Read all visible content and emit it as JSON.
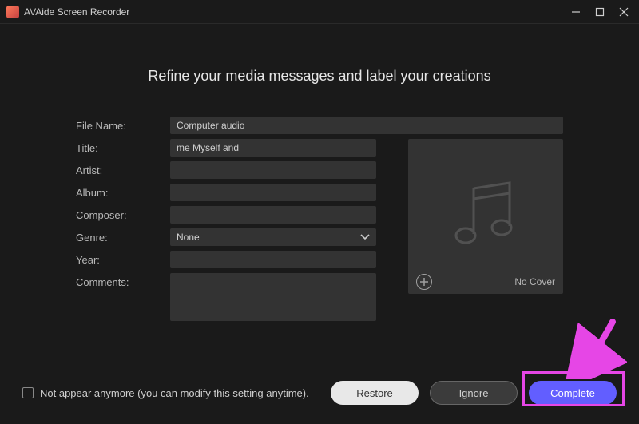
{
  "titlebar": {
    "app_name": "AVAide Screen Recorder"
  },
  "heading": "Refine your media messages and label your creations",
  "labels": {
    "file_name": "File Name:",
    "title": "Title:",
    "artist": "Artist:",
    "album": "Album:",
    "composer": "Composer:",
    "genre": "Genre:",
    "year": "Year:",
    "comments": "Comments:"
  },
  "values": {
    "file_name": "Computer audio",
    "title": "me Myself and ",
    "artist": "",
    "album": "",
    "composer": "",
    "genre": "None",
    "year": "",
    "comments": ""
  },
  "cover": {
    "no_cover": "No Cover"
  },
  "footer": {
    "checkbox_label": "Not appear anymore (you can modify this setting anytime).",
    "restore": "Restore",
    "ignore": "Ignore",
    "complete": "Complete"
  }
}
